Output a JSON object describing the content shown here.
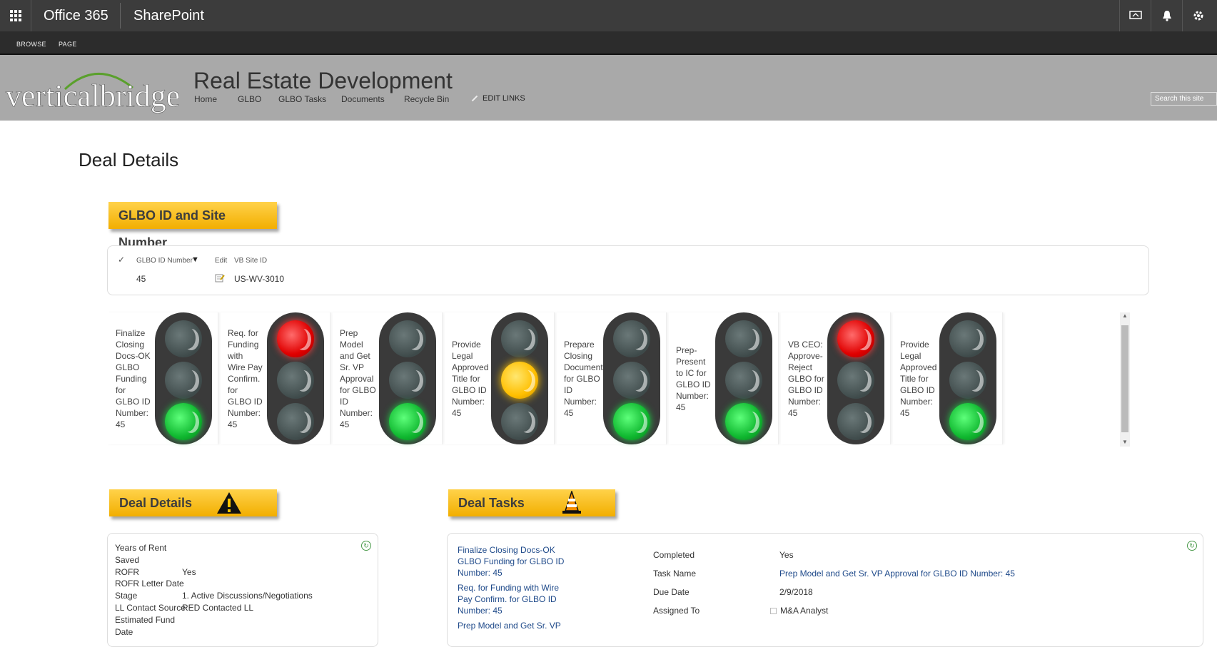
{
  "suitebar": {
    "app_launcher": "app-launcher-icon",
    "brand": "Office 365",
    "product": "SharePoint"
  },
  "ribbon": {
    "tabs": [
      "BROWSE",
      "PAGE"
    ]
  },
  "site": {
    "logo_text": "verticalbridge",
    "title": "Real Estate Development",
    "nav": [
      "Home",
      "GLBO",
      "GLBO Tasks",
      "Documents",
      "Recycle Bin"
    ],
    "edit_links": "EDIT LINKS",
    "search_placeholder": "Search this site"
  },
  "page_title": "Deal Details",
  "glbo_banner": "GLBO ID and Site Number",
  "glbo_table": {
    "headers": {
      "glbo_id": "GLBO ID Number",
      "edit": "Edit",
      "site_id": "VB Site ID"
    },
    "row": {
      "glbo_id": "45",
      "site_id": "US-WV-3010"
    }
  },
  "traffic_lights": [
    {
      "label": [
        "Finalize",
        "Closing",
        "Docs-OK",
        "GLBO",
        "Funding",
        "for",
        "GLBO ID",
        "Number:",
        "45"
      ],
      "active": "green"
    },
    {
      "label": [
        "Req. for",
        "Funding",
        "with",
        "Wire Pay",
        "Confirm.",
        "for",
        "GLBO ID",
        "Number:",
        "45"
      ],
      "active": "red"
    },
    {
      "label": [
        "Prep",
        "Model",
        "and Get",
        "Sr. VP",
        "Approval",
        "for GLBO",
        "ID",
        "Number:",
        "45"
      ],
      "active": "green"
    },
    {
      "label": [
        "Provide",
        "Legal",
        "Approved",
        "Title for",
        "GLBO ID",
        "Number:",
        "45"
      ],
      "active": "yellow"
    },
    {
      "label": [
        "Prepare",
        "Closing",
        "Documents",
        "for GLBO",
        "ID",
        "Number:",
        "45"
      ],
      "active": "green"
    },
    {
      "label": [
        "Prep-",
        "Present",
        "to IC for",
        "GLBO ID",
        "Number:",
        "45"
      ],
      "active": "green"
    },
    {
      "label": [
        "VB CEO:",
        "Approve-",
        "Reject",
        "GLBO for",
        "GLBO ID",
        "Number:",
        "45"
      ],
      "active": "red"
    },
    {
      "label": [
        "Provide",
        "Legal",
        "Approved",
        "Title for",
        "GLBO ID",
        "Number:",
        "45"
      ],
      "active": "green"
    }
  ],
  "deal_details_banner": "Deal Details",
  "deal_tasks_banner": "Deal Tasks",
  "deal_details": [
    {
      "label": "Years of Rent",
      "value": ""
    },
    {
      "label": "Saved",
      "value": ""
    },
    {
      "label": "ROFR",
      "value": "Yes"
    },
    {
      "label": "ROFR Letter Date",
      "value": ""
    },
    {
      "label": "Stage",
      "value": "1. Active Discussions/Negotiations"
    },
    {
      "label": "LL Contact Source",
      "value": "RED Contacted LL"
    },
    {
      "label": "Estimated Fund",
      "value": ""
    },
    {
      "label": "Date",
      "value": ""
    }
  ],
  "deal_tasks": {
    "list": [
      [
        "Finalize Closing Docs-OK",
        "GLBO Funding for GLBO ID",
        "Number: 45"
      ],
      [
        "Req. for Funding with Wire",
        "Pay Confirm. for GLBO ID",
        "Number: 45"
      ],
      [
        "Prep Model and Get Sr. VP"
      ]
    ],
    "details": [
      {
        "label": "Completed",
        "value": "Yes"
      },
      {
        "label": "Task Name",
        "value": "Prep Model and Get Sr. VP Approval for GLBO ID Number: 45"
      },
      {
        "label": "Due Date",
        "value": "2/9/2018"
      },
      {
        "label": "Assigned To",
        "value": "M&A Analyst"
      }
    ]
  },
  "colors": {
    "suitebar": "#3c3c3c",
    "header": "#a9a9a9",
    "banner": "#f5b800",
    "link": "#1f4a8a"
  }
}
